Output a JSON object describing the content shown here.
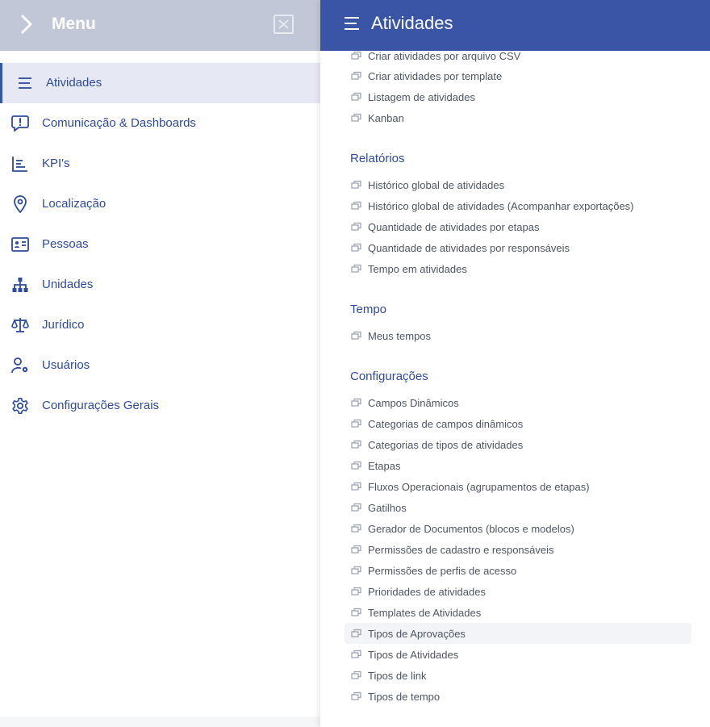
{
  "left_menu": {
    "title": "Menu",
    "items": [
      {
        "label": "Atividades",
        "icon": "hamburger-icon",
        "active": true
      },
      {
        "label": "Comunicação & Dashboards",
        "icon": "message-alert-icon"
      },
      {
        "label": "KPI's",
        "icon": "bar-list-icon"
      },
      {
        "label": "Localização",
        "icon": "map-pin-icon"
      },
      {
        "label": "Pessoas",
        "icon": "id-card-icon"
      },
      {
        "label": "Unidades",
        "icon": "sitemap-icon"
      },
      {
        "label": "Jurídico",
        "icon": "scales-icon"
      },
      {
        "label": "Usuários",
        "icon": "user-gear-icon"
      },
      {
        "label": "Configurações Gerais",
        "icon": "gear-icon"
      }
    ]
  },
  "right_panel": {
    "title": "Atividades",
    "top_links": [
      "Criar atividades por arquivo CSV",
      "Criar atividades por template",
      "Listagem de atividades",
      "Kanban"
    ],
    "sections": [
      {
        "title": "Relatórios",
        "links": [
          "Histórico global de atividades",
          "Histórico global de atividades (Acompanhar exportações)",
          "Quantidade de atividades por etapas",
          "Quantidade de atividades por responsáveis",
          "Tempo em atividades"
        ]
      },
      {
        "title": "Tempo",
        "links": [
          "Meus tempos"
        ]
      },
      {
        "title": "Configurações",
        "links": [
          "Campos Dinâmicos",
          "Categorias de campos dinâmicos",
          "Categorias de tipos de atividades",
          "Etapas",
          "Fluxos Operacionais (agrupamentos de etapas)",
          "Gatilhos",
          "Gerador de Documentos (blocos e modelos)",
          "Permissões de cadastro e responsáveis",
          "Permissões de perfis de acesso",
          "Prioridades de atividades",
          "Templates de Atividades",
          "Tipos de Aprovações",
          "Tipos de Atividades",
          "Tipos de link",
          "Tipos de tempo"
        ]
      }
    ],
    "highlighted_link": "Tipos de Aprovações"
  },
  "colors": {
    "brand": "#3a55a6",
    "menu_text": "#2e4b9c",
    "left_header": "#c1c7d6",
    "link_text": "#4e5563"
  }
}
